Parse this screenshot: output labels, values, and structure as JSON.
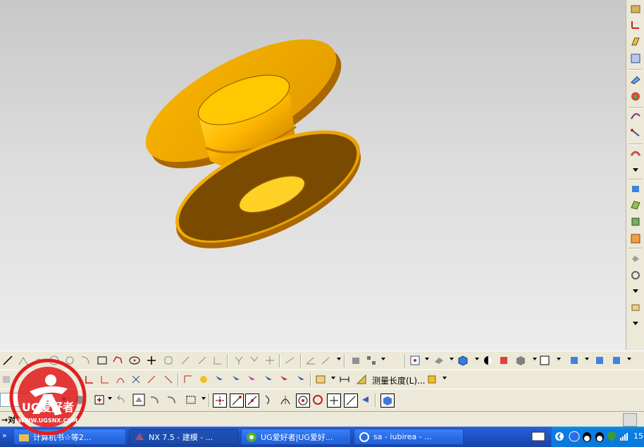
{
  "viewport": {
    "background": "#d4d4d4",
    "model_colors": {
      "face": "#f0a800",
      "dark": "#7a4a00",
      "edge": "#5a3400"
    }
  },
  "right_toolbar": {
    "icons": [
      "orient-view-icon",
      "csys-icon",
      "datum-plane-icon",
      "wcs-icon",
      "extrude-icon",
      "feature-icon",
      "sketch-curve-icon",
      "link-curve-icon",
      "sweep-icon",
      "more-arrow",
      "shade-icon",
      "surface-icon",
      "mesh-icon",
      "analysis-icon",
      "check-icon",
      "fit-icon",
      "more-arrow",
      "snapshot-icon",
      "more-arrow"
    ]
  },
  "toolbar_row2": {
    "measure_length_label": "测量长度(L)..."
  },
  "status": {
    "text": "→对"
  },
  "taskbar": {
    "tasks": [
      {
        "label": "计算机书☆等2...",
        "icon": "folder-icon"
      },
      {
        "label": "NX 7.5 - 建模 - ...",
        "icon": "nx-icon",
        "active": true
      },
      {
        "label": "UG爱好者|UG爱好...",
        "icon": "ie-icon"
      },
      {
        "label": "sa - iubirea - ...",
        "icon": "player-icon"
      }
    ],
    "clock": "15",
    "quicklaunch_chevron": "»"
  },
  "watermark": {
    "brand": "UG爱好者",
    "url": "WWW.UGSNX.COM"
  }
}
